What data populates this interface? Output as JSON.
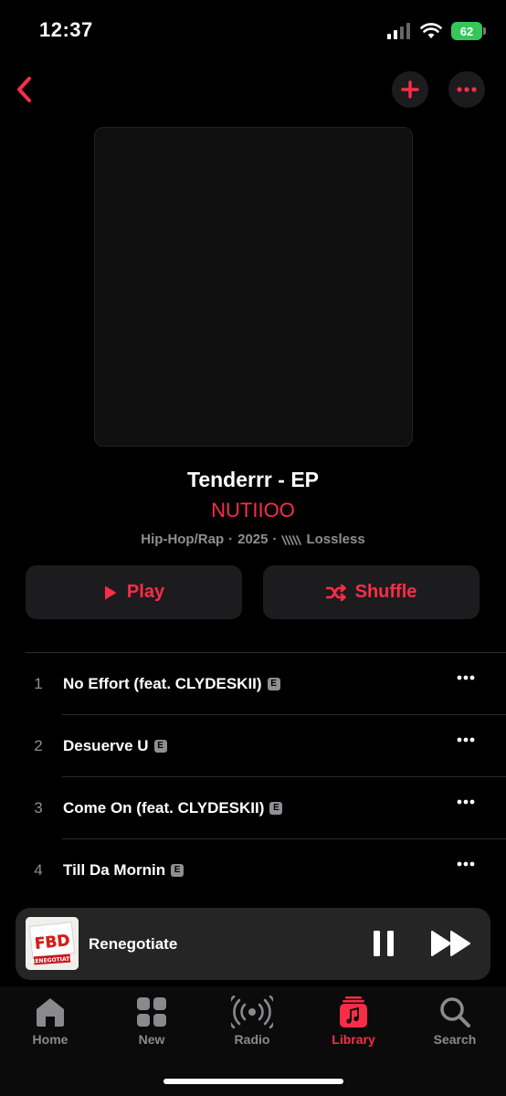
{
  "status": {
    "time": "12:37",
    "battery": "62"
  },
  "album": {
    "title": "Tenderrr - EP",
    "artist": "NUTIIOO",
    "genre": "Hip-Hop/Rap",
    "year": "2025",
    "quality": "Lossless",
    "sep": "·"
  },
  "actions": {
    "play_label": "Play",
    "shuffle_label": "Shuffle"
  },
  "tracks": [
    {
      "num": "1",
      "title": "No Effort (feat. CLYDESKII)",
      "explicit": "E"
    },
    {
      "num": "2",
      "title": "Desuerve U",
      "explicit": "E"
    },
    {
      "num": "3",
      "title": "Come On (feat. CLYDESKII)",
      "explicit": "E"
    },
    {
      "num": "4",
      "title": "Till Da Mornin",
      "explicit": "E"
    }
  ],
  "now_playing": {
    "title": "Renegotiate",
    "art_text": "FBD",
    "art_subtext": "RENEGOTIATE"
  },
  "tabs": [
    {
      "label": "Home",
      "icon": "home-icon"
    },
    {
      "label": "New",
      "icon": "grid-icon"
    },
    {
      "label": "Radio",
      "icon": "radio-icon"
    },
    {
      "label": "Library",
      "icon": "library-icon"
    },
    {
      "label": "Search",
      "icon": "search-icon"
    }
  ],
  "colors": {
    "accent": "#fa2d48",
    "surface": "#1c1c1e",
    "battery": "#35c759"
  }
}
